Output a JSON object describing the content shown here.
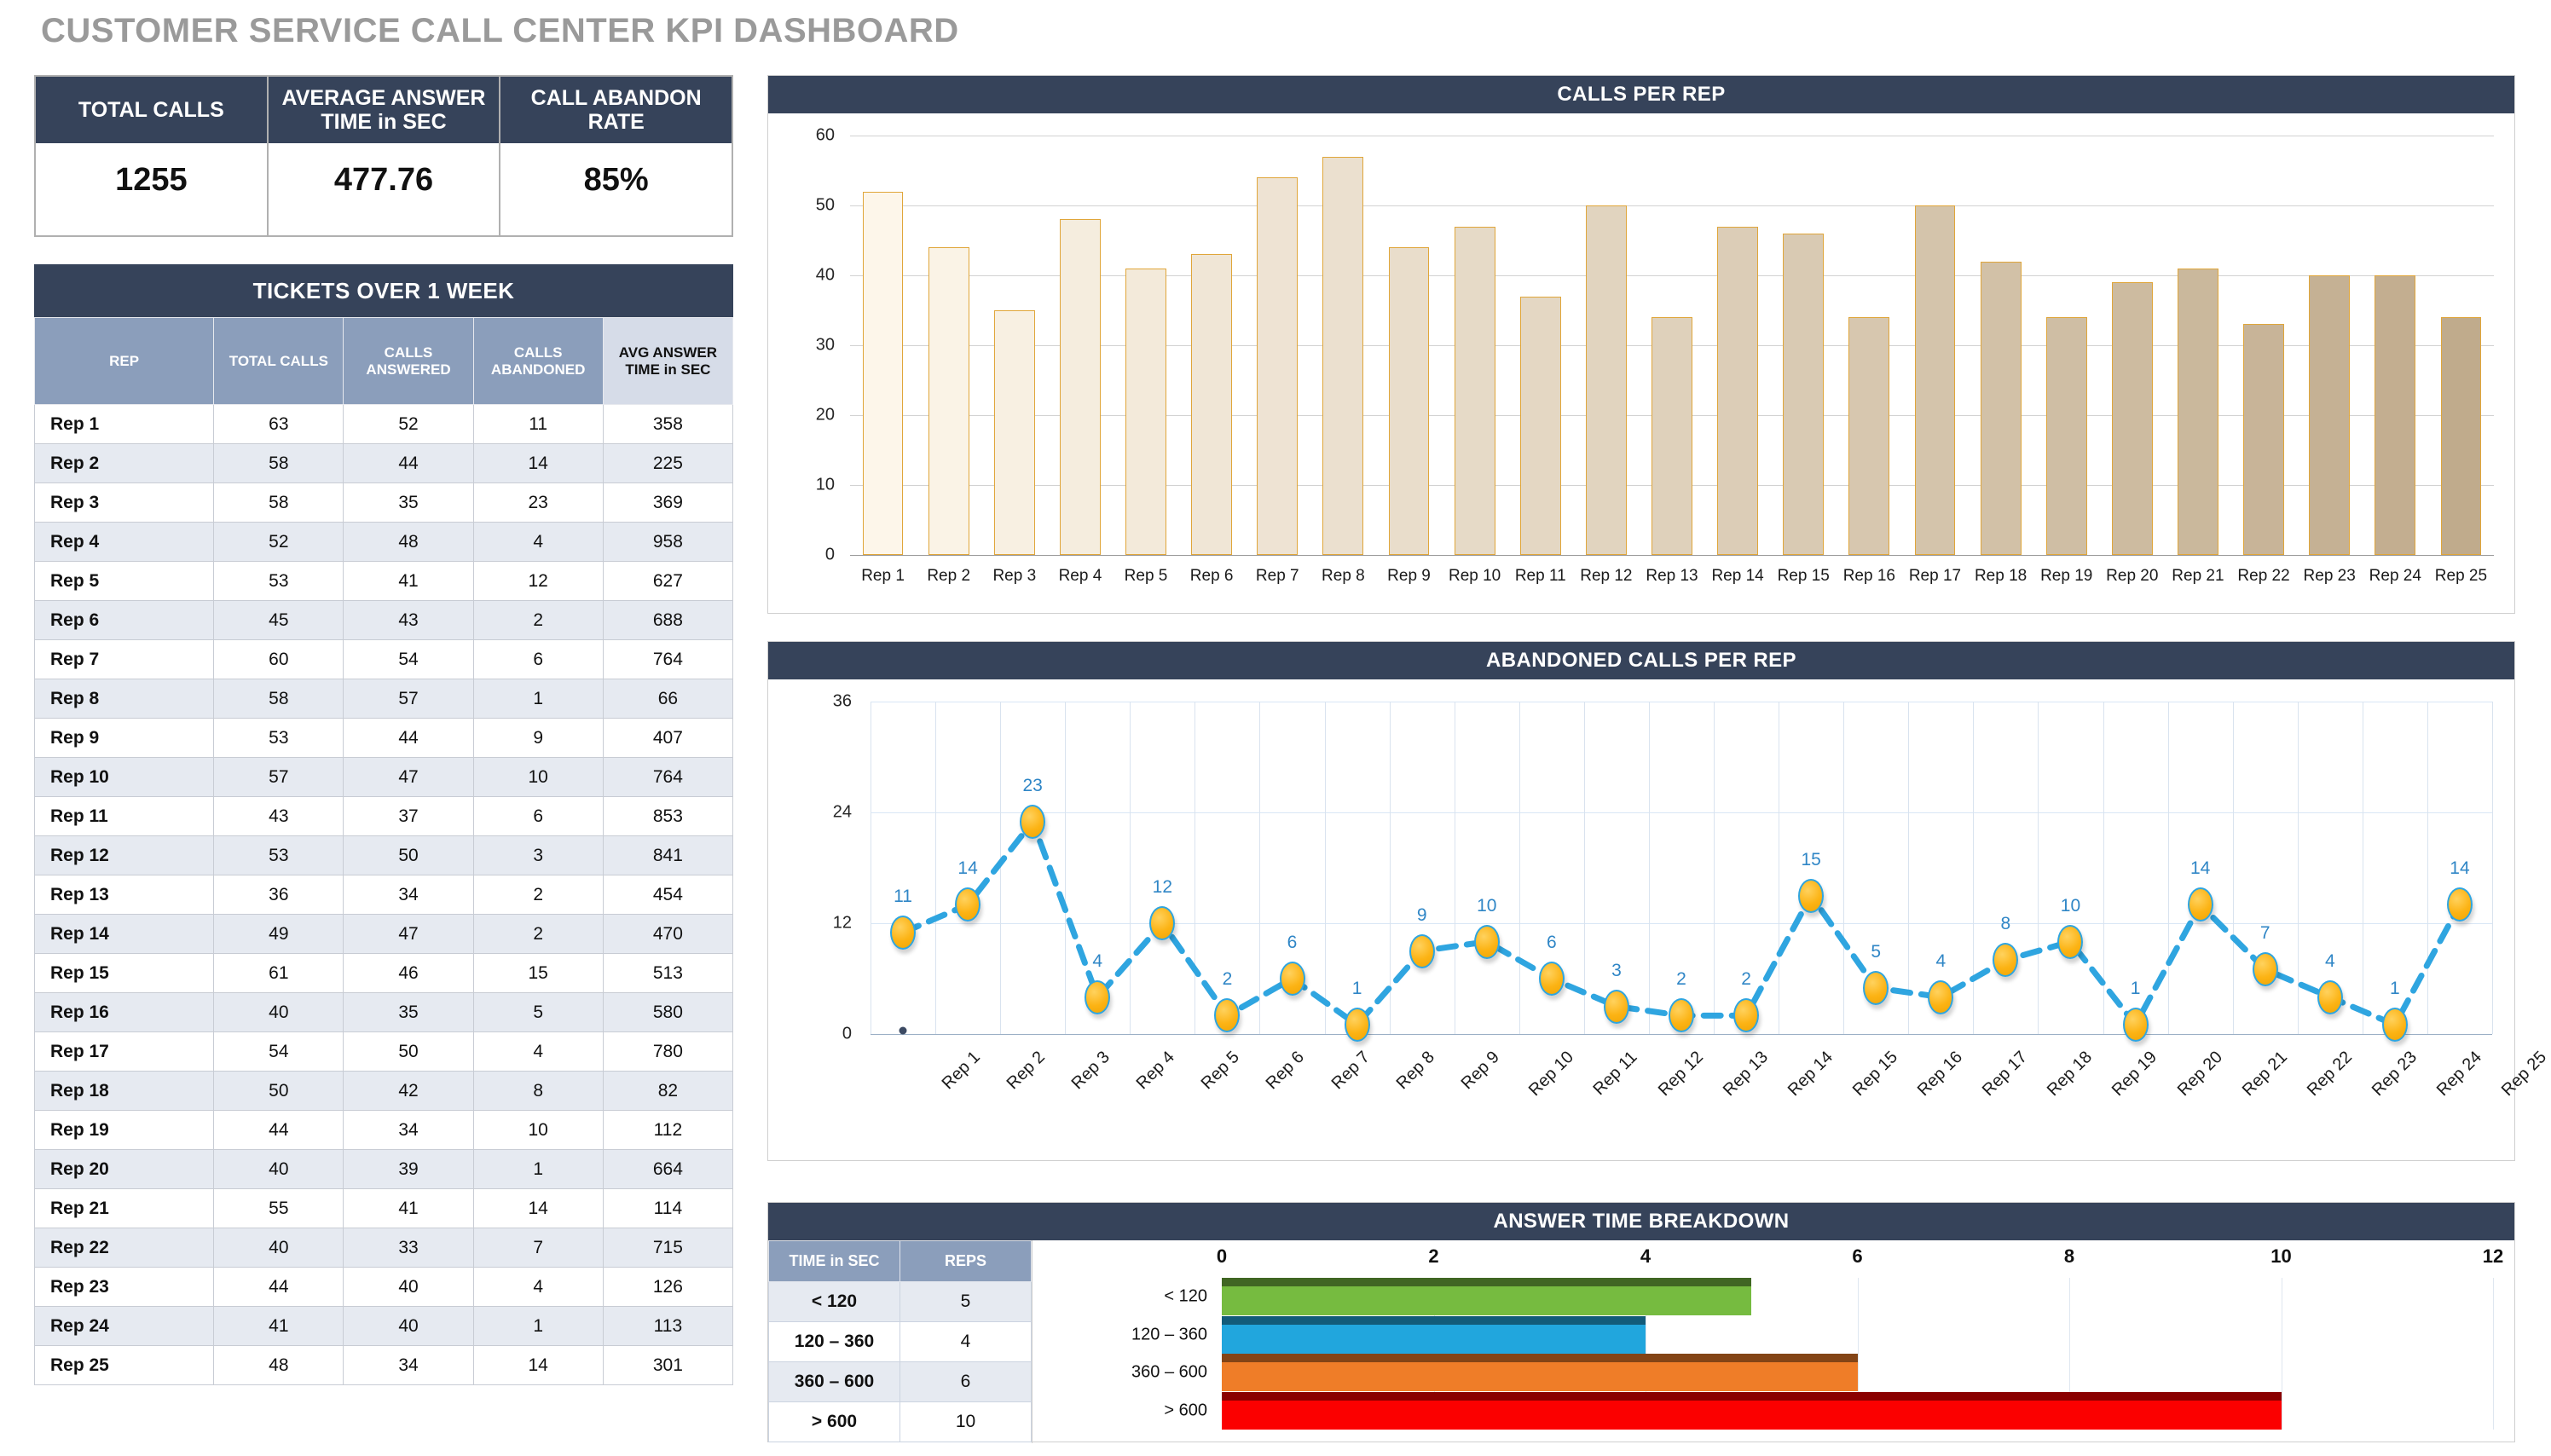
{
  "title": "CUSTOMER SERVICE CALL CENTER KPI DASHBOARD",
  "kpi": {
    "cards": [
      {
        "label": "TOTAL CALLS",
        "value": "1255"
      },
      {
        "label": "AVERAGE ANSWER TIME in SEC",
        "value": "477.76"
      },
      {
        "label": "CALL ABANDON RATE",
        "value": "85%"
      }
    ]
  },
  "tickets": {
    "heading": "TICKETS OVER 1 WEEK",
    "columns": [
      "REP",
      "TOTAL CALLS",
      "CALLS ANSWERED",
      "CALLS ABANDONED",
      "AVG ANSWER TIME in SEC"
    ],
    "rows": [
      [
        "Rep 1",
        "63",
        "52",
        "11",
        "358"
      ],
      [
        "Rep 2",
        "58",
        "44",
        "14",
        "225"
      ],
      [
        "Rep 3",
        "58",
        "35",
        "23",
        "369"
      ],
      [
        "Rep 4",
        "52",
        "48",
        "4",
        "958"
      ],
      [
        "Rep 5",
        "53",
        "41",
        "12",
        "627"
      ],
      [
        "Rep 6",
        "45",
        "43",
        "2",
        "688"
      ],
      [
        "Rep 7",
        "60",
        "54",
        "6",
        "764"
      ],
      [
        "Rep 8",
        "58",
        "57",
        "1",
        "66"
      ],
      [
        "Rep 9",
        "53",
        "44",
        "9",
        "407"
      ],
      [
        "Rep 10",
        "57",
        "47",
        "10",
        "764"
      ],
      [
        "Rep 11",
        "43",
        "37",
        "6",
        "853"
      ],
      [
        "Rep 12",
        "53",
        "50",
        "3",
        "841"
      ],
      [
        "Rep 13",
        "36",
        "34",
        "2",
        "454"
      ],
      [
        "Rep 14",
        "49",
        "47",
        "2",
        "470"
      ],
      [
        "Rep 15",
        "61",
        "46",
        "15",
        "513"
      ],
      [
        "Rep 16",
        "40",
        "35",
        "5",
        "580"
      ],
      [
        "Rep 17",
        "54",
        "50",
        "4",
        "780"
      ],
      [
        "Rep 18",
        "50",
        "42",
        "8",
        "82"
      ],
      [
        "Rep 19",
        "44",
        "34",
        "10",
        "112"
      ],
      [
        "Rep 20",
        "40",
        "39",
        "1",
        "664"
      ],
      [
        "Rep 21",
        "55",
        "41",
        "14",
        "114"
      ],
      [
        "Rep 22",
        "40",
        "33",
        "7",
        "715"
      ],
      [
        "Rep 23",
        "44",
        "40",
        "4",
        "126"
      ],
      [
        "Rep 24",
        "41",
        "40",
        "1",
        "113"
      ],
      [
        "Rep 25",
        "48",
        "34",
        "14",
        "301"
      ]
    ]
  },
  "panels": {
    "calls_title": "CALLS PER REP",
    "abandoned_title": "ABANDONED CALLS PER REP",
    "answer_title": "ANSWER TIME BREAKDOWN"
  },
  "answer_breakdown_table": {
    "columns": [
      "TIME in SEC",
      "REPS"
    ],
    "rows": [
      [
        "< 120",
        "5"
      ],
      [
        "120 – 360",
        "4"
      ],
      [
        "360 – 600",
        "6"
      ],
      [
        "> 600",
        "10"
      ]
    ]
  },
  "chart_data": [
    {
      "type": "bar",
      "title": "CALLS PER REP",
      "xlabel": "",
      "ylabel": "",
      "ylim": [
        0,
        60
      ],
      "yticks": [
        0,
        10,
        20,
        30,
        40,
        50,
        60
      ],
      "grid": true,
      "legend": "none",
      "categories": [
        "Rep 1",
        "Rep 2",
        "Rep 3",
        "Rep 4",
        "Rep 5",
        "Rep 6",
        "Rep 7",
        "Rep 8",
        "Rep 9",
        "Rep 10",
        "Rep 11",
        "Rep 12",
        "Rep 13",
        "Rep 14",
        "Rep 15",
        "Rep 16",
        "Rep 17",
        "Rep 18",
        "Rep 19",
        "Rep 20",
        "Rep 21",
        "Rep 22",
        "Rep 23",
        "Rep 24",
        "Rep 25"
      ],
      "values": [
        52,
        44,
        35,
        48,
        41,
        43,
        54,
        57,
        44,
        47,
        37,
        50,
        34,
        47,
        46,
        34,
        50,
        42,
        34,
        39,
        41,
        33,
        40,
        40,
        34
      ],
      "bar_color_start": "#fdf6ea",
      "bar_color_end": "#c0ab8c",
      "bar_border": "#e0a63a"
    },
    {
      "type": "line",
      "title": "ABANDONED CALLS PER REP",
      "xlabel": "",
      "ylabel": "",
      "ylim": [
        0,
        36
      ],
      "yticks": [
        0,
        12,
        24,
        36
      ],
      "grid": true,
      "legend": "none",
      "line_style": "dashed",
      "line_color": "#2fa5e0",
      "marker_color": "#fcb314",
      "label_color": "#2f86c6",
      "categories": [
        "Rep 1",
        "Rep 2",
        "Rep 3",
        "Rep 4",
        "Rep 5",
        "Rep 6",
        "Rep 7",
        "Rep 8",
        "Rep 9",
        "Rep 10",
        "Rep 11",
        "Rep 12",
        "Rep 13",
        "Rep 14",
        "Rep 15",
        "Rep 16",
        "Rep 17",
        "Rep 18",
        "Rep 19",
        "Rep 20",
        "Rep 21",
        "Rep 22",
        "Rep 23",
        "Rep 24",
        "Rep 25"
      ],
      "values": [
        11,
        14,
        23,
        4,
        12,
        2,
        6,
        1,
        9,
        10,
        6,
        3,
        2,
        2,
        15,
        5,
        4,
        8,
        10,
        1,
        14,
        7,
        4,
        1,
        14
      ]
    },
    {
      "type": "bar",
      "orientation": "horizontal",
      "title": "ANSWER TIME BREAKDOWN",
      "xlabel": "",
      "ylabel": "",
      "xlim": [
        0,
        12
      ],
      "xticks": [
        0,
        2,
        4,
        6,
        8,
        10,
        12
      ],
      "grid": true,
      "legend": "none",
      "categories": [
        "< 120",
        "120 – 360",
        "360 – 600",
        "> 600"
      ],
      "values": [
        5,
        4,
        6,
        10
      ],
      "colors": [
        "#76bb40",
        "#21a6dd",
        "#ef7d28",
        "#fb0000"
      ]
    }
  ]
}
